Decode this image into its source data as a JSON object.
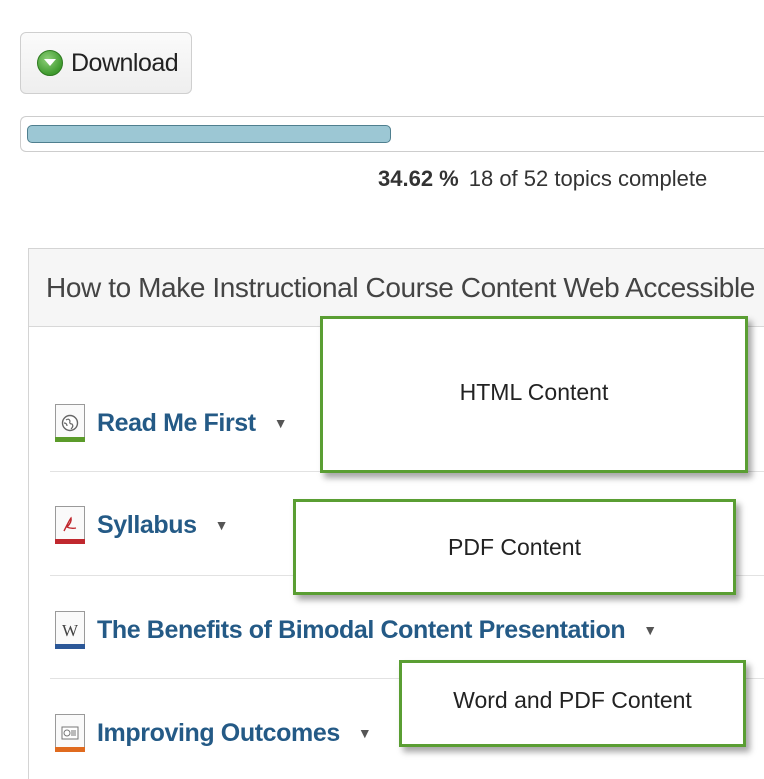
{
  "download": {
    "label": "Download",
    "icon": "download-icon"
  },
  "progress": {
    "fraction": 0.3462,
    "percent_label": "34.62 %",
    "summary": "18 of 52 topics complete",
    "fill_color": "#9cc7d4"
  },
  "module": {
    "title": "How to Make Instructional Course Content Web Accessible"
  },
  "topics": [
    {
      "title": "Read Me First",
      "icon": "html-document-icon",
      "accent": "#5b9b2a"
    },
    {
      "title": "Syllabus",
      "icon": "pdf-document-icon",
      "accent": "#c0282e"
    },
    {
      "title": "The Benefits of Bimodal Content Presentation",
      "icon": "word-document-icon",
      "accent": "#2b5797"
    },
    {
      "title": "Improving Outcomes",
      "icon": "presentation-document-icon",
      "accent": "#e06b1f"
    }
  ],
  "callouts": [
    "HTML Content",
    "PDF Content",
    "Word and PDF Content"
  ]
}
